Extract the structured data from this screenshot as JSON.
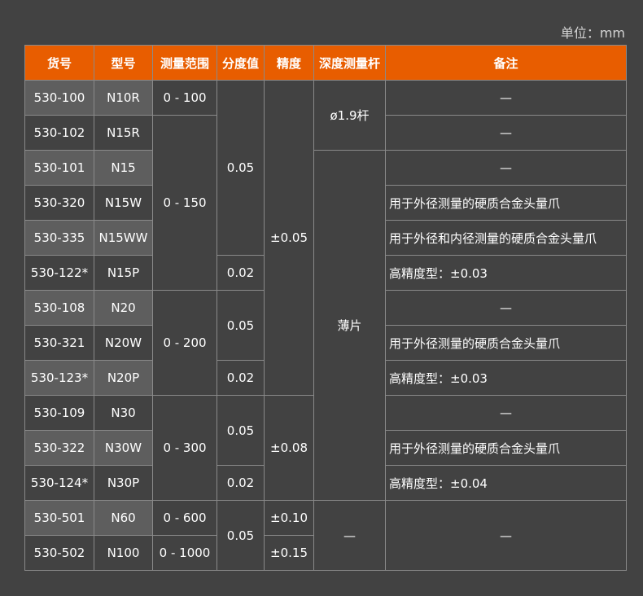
{
  "unit_label": "单位：mm",
  "headers": [
    "货号",
    "型号",
    "测量范围",
    "分度值",
    "精度",
    "深度测量杆",
    "备注"
  ],
  "dash": "—",
  "rows": [
    {
      "code": "530-100",
      "model": "N10R",
      "note": "—"
    },
    {
      "code": "530-102",
      "model": "N15R",
      "note": "—"
    },
    {
      "code": "530-101",
      "model": "N15",
      "note": "—"
    },
    {
      "code": "530-320",
      "model": "N15W",
      "note": "用于外径测量的硬质合金头量爪"
    },
    {
      "code": "530-335",
      "model": "N15WW",
      "note": "用于外径和内径测量的硬质合金头量爪"
    },
    {
      "code": "530-122*",
      "model": "N15P",
      "note": "高精度型：±0.03"
    },
    {
      "code": "530-108",
      "model": "N20",
      "note": "—"
    },
    {
      "code": "530-321",
      "model": "N20W",
      "note": "用于外径测量的硬质合金头量爪"
    },
    {
      "code": "530-123*",
      "model": "N20P",
      "note": "高精度型：±0.03"
    },
    {
      "code": "530-109",
      "model": "N30",
      "note": "—"
    },
    {
      "code": "530-322",
      "model": "N30W",
      "note": "用于外径测量的硬质合金头量爪"
    },
    {
      "code": "530-124*",
      "model": "N30P",
      "note": "高精度型：±0.04"
    },
    {
      "code": "530-501",
      "model": "N60",
      "note": "—"
    },
    {
      "code": "530-502",
      "model": "N100",
      "note": "—"
    }
  ],
  "ranges": [
    "0 - 100",
    "0 - 150",
    "0 - 200",
    "0 - 300",
    "0 - 600",
    "0 - 1000"
  ],
  "resolutions": [
    "0.05",
    "0.02",
    "0.05",
    "0.02",
    "0.05",
    "0.02",
    "0.05"
  ],
  "accuracies": [
    "±0.05",
    "±0.08",
    "±0.10",
    "±0.15"
  ],
  "depth_rods": [
    "ø1.9杆",
    "薄片",
    "—"
  ]
}
